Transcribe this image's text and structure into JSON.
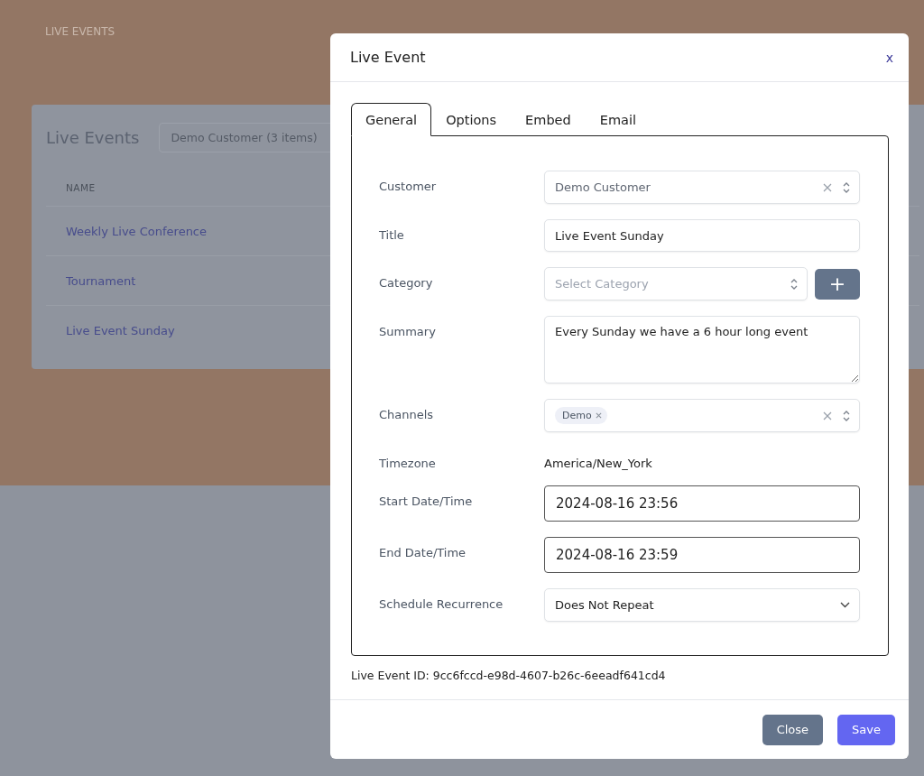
{
  "page": {
    "heading": "LIVE EVENTS",
    "card": {
      "title": "Live Events",
      "filter": "Demo Customer (3 items)",
      "columns": [
        "NAME"
      ],
      "rows": [
        "Weekly Live Conference",
        "Tournament",
        "Live Event Sunday"
      ]
    }
  },
  "modal": {
    "title": "Live Event",
    "close_glyph": "x",
    "tabs": [
      {
        "label": "General",
        "selected": true
      },
      {
        "label": "Options",
        "selected": false
      },
      {
        "label": "Embed",
        "selected": false
      },
      {
        "label": "Email",
        "selected": false
      }
    ],
    "fields": [
      {
        "label": "Customer",
        "kind": "select",
        "value": "Demo Customer",
        "clearable": true
      },
      {
        "label": "Title",
        "kind": "input",
        "value": "Live Event Sunday"
      },
      {
        "label": "Category",
        "kind": "select-add",
        "placeholder": "Select Category",
        "add_glyph": "+"
      },
      {
        "label": "Summary",
        "kind": "textarea",
        "value": "Every Sunday we have a 6 hour long event"
      },
      {
        "label": "Channels",
        "kind": "tags",
        "tags": [
          "Demo"
        ],
        "clearable": true
      },
      {
        "label": "Timezone",
        "kind": "text",
        "value": "America/New_York"
      },
      {
        "label": "Start Date/Time",
        "kind": "datetime",
        "value": "2024-08-16 23:56"
      },
      {
        "label": "End Date/Time",
        "kind": "datetime",
        "value": "2024-08-16 23:59"
      },
      {
        "label": "Schedule Recurrence",
        "kind": "dropdown",
        "value": "Does Not Repeat"
      }
    ],
    "id_text": "Live Event ID: 9cc6fccd-e98d-4607-b26c-6eeadf641cd4",
    "buttons": [
      {
        "label": "Close",
        "kind": "secondary"
      },
      {
        "label": "Save",
        "kind": "primary"
      }
    ]
  }
}
